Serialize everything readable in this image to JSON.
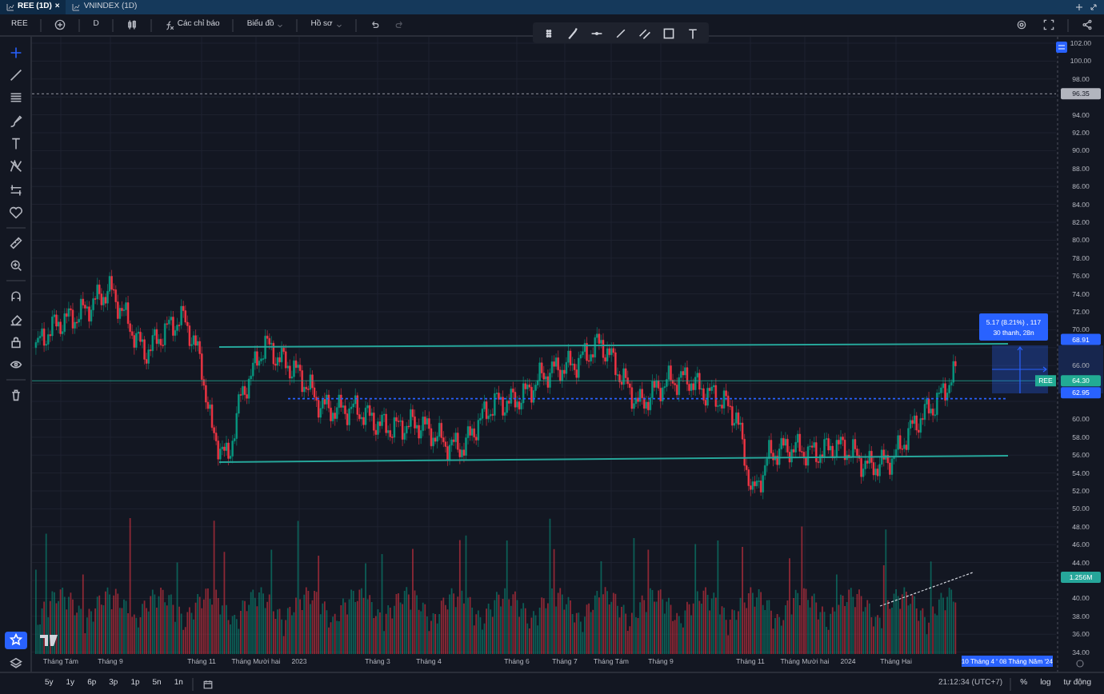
{
  "tabs": [
    {
      "label": "REE (1D)",
      "selected": true,
      "close": "×"
    },
    {
      "label": "VNINDEX (1D)",
      "selected": false
    }
  ],
  "toolbar": {
    "symbol": "REE",
    "interval": "D",
    "indicators": "Các chỉ báo",
    "chart_menu": "Biểu đồ",
    "profile_menu": "Hồ sơ"
  },
  "left_tools": [
    {
      "kind": "cross",
      "selected": true
    },
    {
      "kind": "line",
      "selected": false
    },
    {
      "kind": "fib",
      "selected": false
    },
    {
      "kind": "brush",
      "selected": false
    },
    {
      "kind": "text",
      "selected": false
    },
    {
      "kind": "pattern",
      "selected": false
    },
    {
      "kind": "forecast",
      "selected": false
    },
    {
      "kind": "heart",
      "selected": false
    },
    {
      "kind": "ruler",
      "selected": false
    },
    {
      "kind": "zoom",
      "selected": false
    },
    {
      "kind": "magnet",
      "selected": false
    },
    {
      "kind": "eraser",
      "selected": false
    },
    {
      "kind": "lock",
      "selected": false
    },
    {
      "kind": "eye",
      "selected": false
    },
    {
      "kind": "trash",
      "selected": false
    },
    {
      "kind": "star",
      "selected": true
    },
    {
      "kind": "layers",
      "selected": false
    }
  ],
  "price_axis": {
    "ticks": [
      "102.00",
      "100.00",
      "98.00",
      "94.00",
      "92.00",
      "90.00",
      "88.00",
      "86.00",
      "84.00",
      "82.00",
      "80.00",
      "78.00",
      "76.00",
      "74.00",
      "72.00",
      "70.00",
      "66.00",
      "60.00",
      "58.00",
      "56.00",
      "54.00",
      "52.00",
      "50.00",
      "48.00",
      "46.00",
      "44.00",
      "40.00",
      "38.00",
      "36.00",
      "34.00"
    ],
    "markers": [
      {
        "label": "96.35",
        "kind": "price",
        "color": "#b2b5be"
      },
      {
        "label": "68.91",
        "kind": "price",
        "color": "#2962ff"
      },
      {
        "label": "64.30",
        "kind": "price",
        "color": "#22ab94",
        "tag": "REE"
      },
      {
        "label": "62.95",
        "kind": "price",
        "color": "#2962ff"
      },
      {
        "label": "1.256M",
        "kind": "volume",
        "color": "#26a69a"
      }
    ]
  },
  "measure": {
    "change": "5.17 (8.21%) , 117",
    "span": "30 thanh, 28n"
  },
  "time_axis": {
    "labels": [
      "Tháng Tám",
      "Tháng 9",
      "Tháng 11",
      "Tháng Mười hai",
      "2023",
      "Tháng 3",
      "Tháng 4",
      "Tháng 6",
      "Tháng 7",
      "Tháng Tám",
      "Tháng 9",
      "Tháng 11",
      "Tháng Mười hai",
      "2024",
      "Tháng Hai"
    ],
    "range": "10 Tháng 4 ' 08 Tháng Năm '24"
  },
  "bottom_bar": {
    "ranges": [
      "5y",
      "1y",
      "6p",
      "3p",
      "1p",
      "5n",
      "1n"
    ],
    "clock": "21:12:34 (UTC+7)",
    "scale_buttons": [
      "%",
      "log",
      "tự động"
    ]
  }
}
